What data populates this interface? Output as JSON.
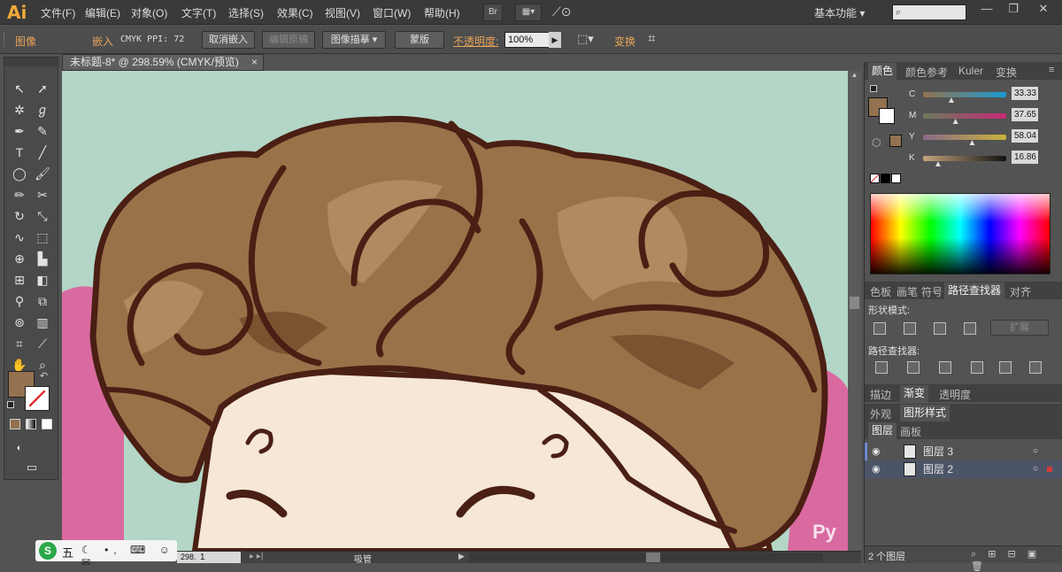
{
  "app": {
    "logo": "Ai",
    "menu": [
      "文件(F)",
      "编辑(E)",
      "对象(O)",
      "文字(T)",
      "选择(S)",
      "效果(C)",
      "视图(V)",
      "窗口(W)",
      "帮助(H)"
    ],
    "br_button": "Br",
    "workspace": "基本功能",
    "window_controls": [
      "—",
      "❐",
      "✕"
    ]
  },
  "control_bar": {
    "object_type": "图像",
    "embed": "嵌入",
    "color_info": "CMYK  PPI: 72",
    "unembed_button": "取消嵌入",
    "edit_original_button": "编辑原稿",
    "image_trace_button": "图像描摹",
    "mask_button": "蒙版",
    "opacity_label": "不透明度:",
    "opacity_value": "100%",
    "transform_label": "变换"
  },
  "document": {
    "tab_title": "未标题-8* @ 298.59% (CMYK/预览)",
    "tab_close": "×"
  },
  "status_bar": {
    "zoom": "298.59",
    "artboard": "1",
    "tool": "吸管"
  },
  "ime": {
    "label": "五"
  },
  "color_panel": {
    "tabs": [
      "颜色",
      "颜色参考",
      "Kuler",
      "变换"
    ],
    "channels": [
      {
        "name": "C",
        "value": "33.33",
        "fraction": 0.33
      },
      {
        "name": "M",
        "value": "37.65",
        "fraction": 0.38
      },
      {
        "name": "Y",
        "value": "58.04",
        "fraction": 0.58
      },
      {
        "name": "K",
        "value": "16.86",
        "fraction": 0.17
      }
    ],
    "fill_color": "#94724f"
  },
  "pathfinder_panel": {
    "tabs": [
      "色板",
      "画笔",
      "符号",
      "路径查找器",
      "对齐"
    ],
    "shape_modes_label": "形状模式:",
    "expand_button": "扩展",
    "pathfinders_label": "路径查找器:"
  },
  "gradient_panel": {
    "tabs": [
      "描边",
      "渐变",
      "透明度"
    ]
  },
  "appearance_panel": {
    "tabs": [
      "外观",
      "图形样式"
    ]
  },
  "layers_panel": {
    "tabs": [
      "图层",
      "画板"
    ],
    "layers": [
      {
        "name": "图层 3",
        "color": "#6f8ad4"
      },
      {
        "name": "图层 2",
        "color": "#d43a3a"
      }
    ],
    "count": "2 个图层"
  },
  "colors": {
    "hair": "#9a7249",
    "hair_light": "#b08a60",
    "hair_shadow": "#7a5331",
    "outline": "#4a1f14",
    "skin": "#f6e7d6",
    "background": "#b3d6c6",
    "shirt": "#d96aa0"
  }
}
